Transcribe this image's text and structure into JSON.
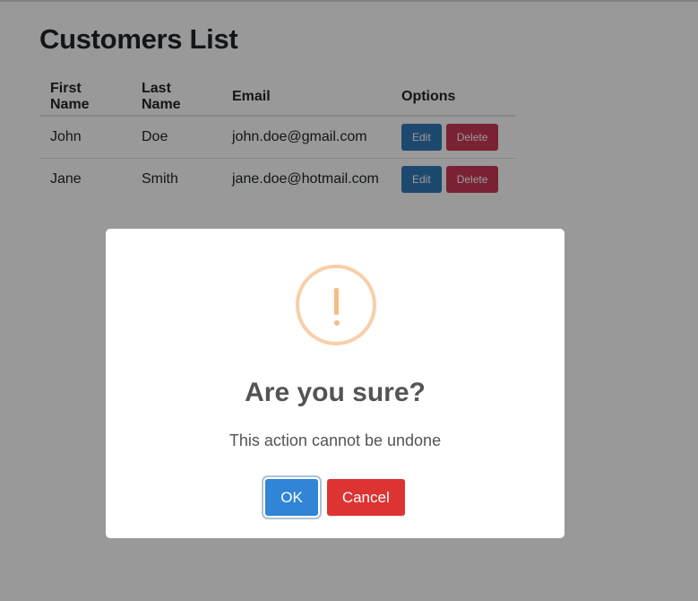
{
  "page": {
    "title": "Customers List"
  },
  "table": {
    "headers": {
      "first_name": "First Name",
      "last_name": "Last Name",
      "email": "Email",
      "options": "Options"
    },
    "rows": [
      {
        "first_name": "John",
        "last_name": "Doe",
        "email": "john.doe@gmail.com",
        "edit_label": "Edit",
        "delete_label": "Delete"
      },
      {
        "first_name": "Jane",
        "last_name": "Smith",
        "email": "jane.doe@hotmail.com",
        "edit_label": "Edit",
        "delete_label": "Delete"
      }
    ]
  },
  "dialog": {
    "icon": "warning-exclamation-icon",
    "title": "Are you sure?",
    "text": "This action cannot be undone",
    "ok_label": "OK",
    "cancel_label": "Cancel"
  },
  "colors": {
    "edit_button": "#337ab7",
    "delete_button": "#cc3a55",
    "ok_button": "#3085d6",
    "cancel_button": "#dd3333",
    "warning_icon": "#f8bb86"
  }
}
